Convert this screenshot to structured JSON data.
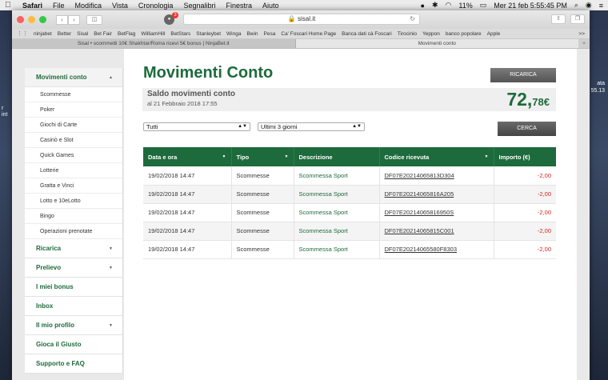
{
  "menubar": {
    "app": "Safari",
    "items": [
      "File",
      "Modifica",
      "Vista",
      "Cronologia",
      "Segnalibri",
      "Finestra",
      "Aiuto"
    ],
    "battery": "11%",
    "datetime": "Mer 21 feb  5:55:45 PM"
  },
  "desktop": {
    "right_line1": "ata",
    "right_line2": "55.13",
    "left_line1": "r",
    "left_line2": "int"
  },
  "browser": {
    "url": "sisal.it",
    "extension_badge": "3",
    "bookmarks": [
      "ninjabet",
      "Better",
      "Sisal",
      "Bet Fair",
      "BetFlag",
      "WilliamHill",
      "BetStars",
      "Stanleybet",
      "Winga",
      "Bwin",
      "Pesa",
      "Ca' Foscari Home Page",
      "Banca dati cà Foscari",
      "Tirocinio",
      "Yeppon",
      "banco popolare",
      "Apple"
    ],
    "bookmarks_more": ">>",
    "tabs": [
      {
        "label": "Sisal • scommetti 10€ Shakhtar/Roma ricevi 5€ bonus | NinjaBet.it"
      },
      {
        "label": "Movimenti conto"
      }
    ]
  },
  "sidebar": {
    "sections": [
      {
        "label": "Movimenti conto",
        "open": true,
        "sub": [
          "Scommesse",
          "Poker",
          "Giochi di Carte",
          "Casinò e Slot",
          "Quick Games",
          "Lotterie",
          "Gratta e Vinci",
          "Lotto e 10eLotto",
          "Bingo",
          "Operazioni prenotate"
        ]
      },
      {
        "label": "Ricarica",
        "caret": true
      },
      {
        "label": "Prelievo",
        "caret": true
      },
      {
        "label": "I miei bonus",
        "caret": false
      },
      {
        "label": "Inbox",
        "caret": false
      },
      {
        "label": "Il mio profilo",
        "caret": true
      },
      {
        "label": "Gioca il Giusto",
        "caret": false
      },
      {
        "label": "Supporto e FAQ",
        "caret": false
      }
    ]
  },
  "main": {
    "title": "Movimenti Conto",
    "ricarica_button": "RICARICA",
    "saldo_label": "Saldo movimenti conto",
    "saldo_date": "al 21 Febbraio 2018 17:55",
    "saldo_int": "72,",
    "saldo_dec": "78€",
    "filter_type": "Tutti",
    "filter_period": "Ultimi 3 giorni",
    "cerca_button": "CERCA",
    "table": {
      "headers": [
        "Data e ora",
        "Tipo",
        "Descrizione",
        "Codice ricevuta",
        "Importo (€)"
      ],
      "rows": [
        [
          "19/02/2018  14:47",
          "Scommesse",
          "Scommessa Sport",
          "DF07E20214065813D304",
          "-2,00"
        ],
        [
          "19/02/2018  14:47",
          "Scommesse",
          "Scommessa Sport",
          "DF07E20214065816A205",
          "-2,00"
        ],
        [
          "19/02/2018  14:47",
          "Scommesse",
          "Scommessa Sport",
          "DF07E20214065816950S",
          "-2,00"
        ],
        [
          "19/02/2018  14:47",
          "Scommesse",
          "Scommessa Sport",
          "DF07E20214065815C001",
          "-2,00"
        ],
        [
          "19/02/2018  14:47",
          "Scommesse",
          "Scommessa Sport",
          "DF07E20214065580F8303",
          "-2,00"
        ]
      ]
    }
  },
  "colors": {
    "brand_green": "#1d6b3c",
    "negative": "#dd2222"
  }
}
